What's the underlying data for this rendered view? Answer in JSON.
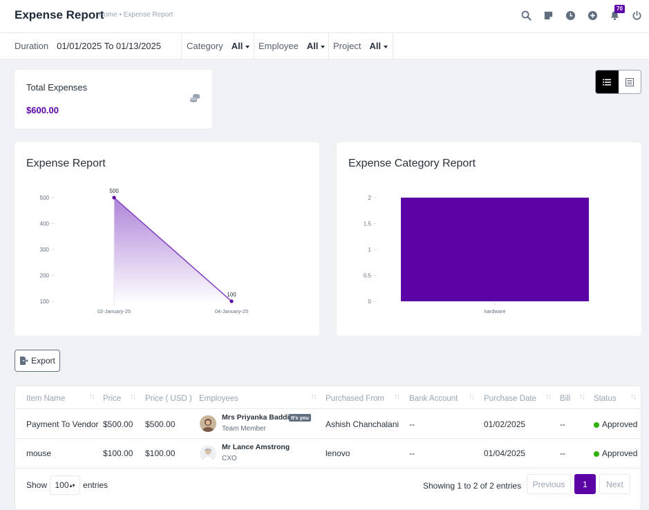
{
  "header": {
    "title": "Expense Report",
    "breadcrumb": "Home • Expense Report",
    "notification_count": "70",
    "icons": [
      "search-icon",
      "sticky-note-icon",
      "clock-icon",
      "add-circle-icon",
      "bell-icon",
      "power-icon"
    ]
  },
  "filters": {
    "duration_label": "Duration",
    "duration_value": "01/01/2025 To 01/13/2025",
    "category_label": "Category",
    "category_value": "All",
    "employee_label": "Employee",
    "employee_value": "All",
    "project_label": "Project",
    "project_value": "All"
  },
  "summary": {
    "total_label": "Total Expenses",
    "total_value": "$600.00",
    "icon": "coins-icon"
  },
  "view_toggle": {
    "active": "list",
    "options": [
      "list-view-icon",
      "report-view-icon"
    ]
  },
  "colors": {
    "accent": "#5c03a6",
    "approved": "#2cb100",
    "line": "#7b3ac0",
    "area_top": "#a06fd2"
  },
  "chart_data": [
    {
      "type": "area",
      "title": "Expense Report",
      "x": [
        "02-January-25",
        "04-January-25"
      ],
      "values": [
        500,
        100
      ],
      "data_labels": [
        "500",
        "100"
      ],
      "yticks": [
        "500",
        "400",
        "300",
        "200",
        "100"
      ],
      "ylim": [
        100,
        500
      ]
    },
    {
      "type": "bar",
      "title": "Expense Category Report",
      "categories": [
        "hardware"
      ],
      "values": [
        2
      ],
      "yticks": [
        "2",
        "1.5",
        "1",
        "0.5",
        "0"
      ],
      "ylim": [
        0,
        2
      ]
    }
  ],
  "export_label": "Export",
  "table": {
    "columns": [
      "Item Name",
      "Price",
      "Price ( USD )",
      "Employees",
      "Purchased From",
      "Bank Account",
      "Purchase Date",
      "Bill",
      "Status"
    ],
    "rows": [
      {
        "item": "Payment To Vendor",
        "price": "$500.00",
        "price_usd": "$500.00",
        "employee_name": "Mrs Priyanka Baddi",
        "employee_tag": "It's you",
        "employee_role": "Team Member",
        "purchased_from": "Ashish Chanchalani",
        "bank_account": "--",
        "purchase_date": "01/02/2025",
        "bill": "--",
        "status": "Approved"
      },
      {
        "item": "mouse",
        "price": "$100.00",
        "price_usd": "$100.00",
        "employee_name": "Mr Lance Amstrong",
        "employee_tag": "",
        "employee_role": "CXO",
        "purchased_from": "lenovo",
        "bank_account": "--",
        "purchase_date": "01/04/2025",
        "bill": "--",
        "status": "Approved"
      }
    ]
  },
  "pagination": {
    "show_label": "Show",
    "entries_value": "100",
    "entries_label": "entries",
    "info": "Showing 1 to 2 of 2 entries",
    "previous": "Previous",
    "current": "1",
    "next": "Next"
  }
}
